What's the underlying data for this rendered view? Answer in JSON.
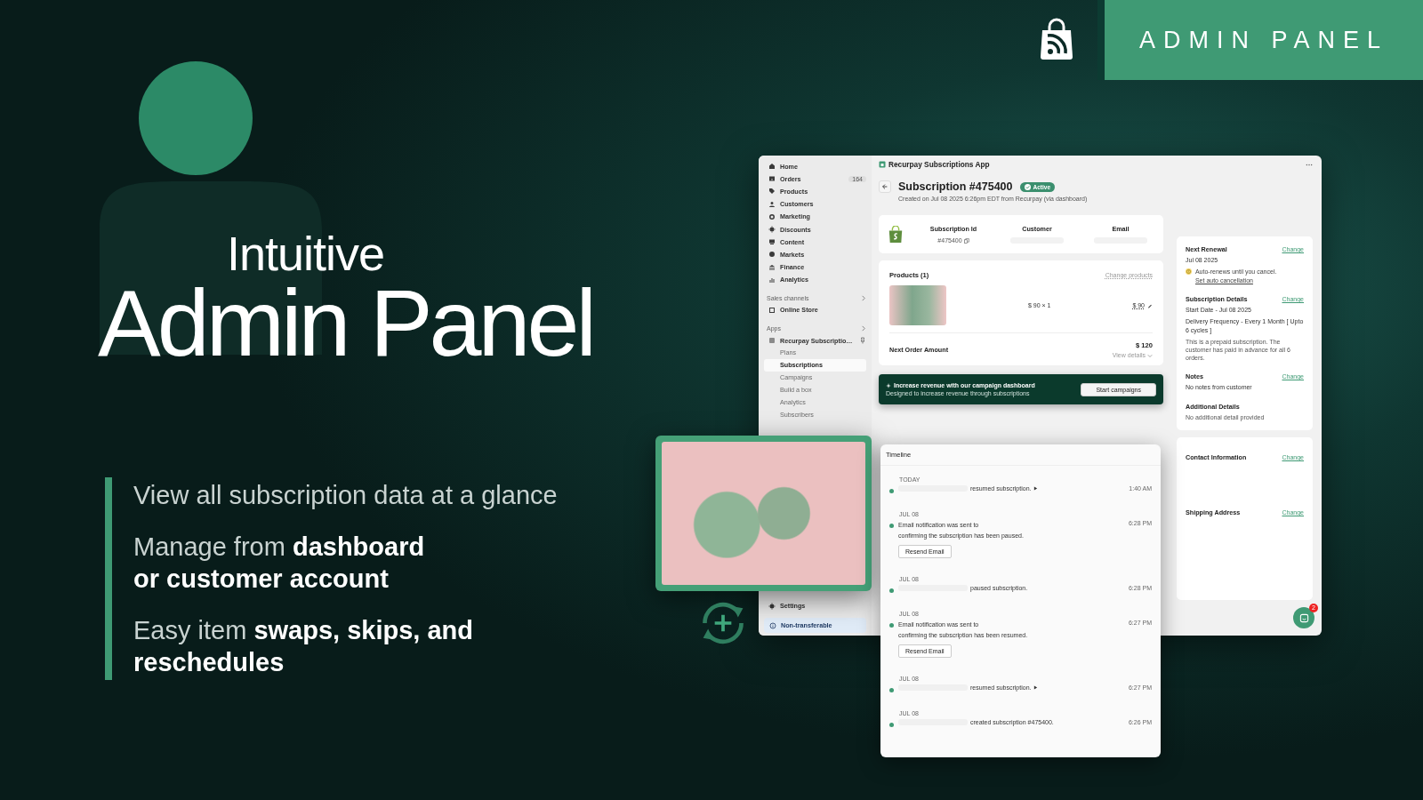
{
  "banner": {
    "title": "ADMIN PANEL"
  },
  "hero": {
    "kicker": "Intuitive",
    "title": "Admin Panel"
  },
  "features": [
    {
      "lines": [
        "View all subscription data at a glance"
      ]
    },
    {
      "lines": [
        "Manage from **dashboard**",
        "**or customer account**"
      ]
    },
    {
      "lines": [
        "Easy item **swaps, skips, and**",
        "**reschedules**"
      ]
    }
  ],
  "sidebar": {
    "nav": [
      {
        "label": "Home"
      },
      {
        "label": "Orders",
        "badge": "164"
      },
      {
        "label": "Products"
      },
      {
        "label": "Customers"
      },
      {
        "label": "Marketing"
      },
      {
        "label": "Discounts"
      },
      {
        "label": "Content"
      },
      {
        "label": "Markets"
      },
      {
        "label": "Finance"
      },
      {
        "label": "Analytics"
      }
    ],
    "sales_channels": {
      "heading": "Sales channels",
      "items": [
        "Online Store"
      ]
    },
    "apps": {
      "heading": "Apps",
      "app": "Recurpay Subscriptio…",
      "children": [
        {
          "label": "Plans",
          "selected": false
        },
        {
          "label": "Subscriptions",
          "selected": true
        },
        {
          "label": "Campaigns",
          "selected": false
        },
        {
          "label": "Build a box",
          "selected": false
        },
        {
          "label": "Analytics",
          "selected": false
        },
        {
          "label": "Subscribers",
          "selected": false
        }
      ]
    },
    "settings": "Settings",
    "notice": "Non-transferable"
  },
  "app": {
    "title": "Recurpay Subscriptions App"
  },
  "subscription": {
    "title": "Subscription #475400",
    "status": "Active",
    "created": "Created on Jul 08 2025 6:26pm EDT from Recurpay (via dashboard)",
    "summary": [
      {
        "label": "Subscription Id",
        "value": "#475400"
      },
      {
        "label": "Customer"
      },
      {
        "label": "Email"
      }
    ],
    "products": {
      "heading": "Products (1)",
      "action": "Change products",
      "unit": "$ 90 × 1",
      "total": "$ 90"
    },
    "next_order": {
      "label": "Next Order Amount",
      "amount": "$ 120",
      "link": "View details"
    },
    "campaign": {
      "title": "Increase revenue with our campaign dashboard",
      "subtitle": "Designed to increase revenue through subscriptions",
      "button": "Start campaigns"
    }
  },
  "details": [
    {
      "title": "Next Renewal",
      "action": "Change",
      "lines": [
        "Jul 08 2025"
      ],
      "warning": "Auto-renews until you cancel.",
      "warning_link": "Set auto cancellation"
    },
    {
      "title": "Subscription Details",
      "action": "Change",
      "lines": [
        "Start Date - Jul 08 2025",
        "Delivery Frequency - Every 1 Month [ Upto 6 cycles ]"
      ],
      "note": "This is a prepaid subscription. The customer has paid in advance for all 6 orders."
    },
    {
      "title": "Notes",
      "action": "Change",
      "lines": [
        "No notes from customer"
      ]
    },
    {
      "title": "Additional Details",
      "note": "No additional detail provided"
    }
  ],
  "contact": [
    {
      "title": "Contact Information",
      "action": "Change"
    },
    {
      "title": "Shipping Address",
      "action": "Change"
    }
  ],
  "chat_badge": "2",
  "timeline": {
    "title": "Timeline",
    "events": [
      {
        "date": "TODAY",
        "text": "resumed subscription.",
        "time": "1:40 AM",
        "kind": "actor",
        "caret": true
      },
      {
        "date": "JUL 08",
        "text": "Email notification was sent to",
        "detail": "confirming the subscription has been paused.",
        "time": "6:28 PM",
        "kind": "email",
        "button": "Resend Email"
      },
      {
        "date": "JUL 08",
        "text": "paused subscription.",
        "time": "6:28 PM",
        "kind": "actor",
        "caret": false
      },
      {
        "date": "JUL 08",
        "text": "Email notification was sent to",
        "detail": "confirming the subscription has been resumed.",
        "time": "6:27 PM",
        "kind": "email",
        "button": "Resend Email"
      },
      {
        "date": "JUL 08",
        "text": "resumed subscription.",
        "time": "6:27 PM",
        "kind": "actor",
        "caret": true
      },
      {
        "date": "JUL 08",
        "text": "created subscription #475400.",
        "time": "6:26 PM",
        "kind": "actor",
        "caret": false
      }
    ]
  }
}
